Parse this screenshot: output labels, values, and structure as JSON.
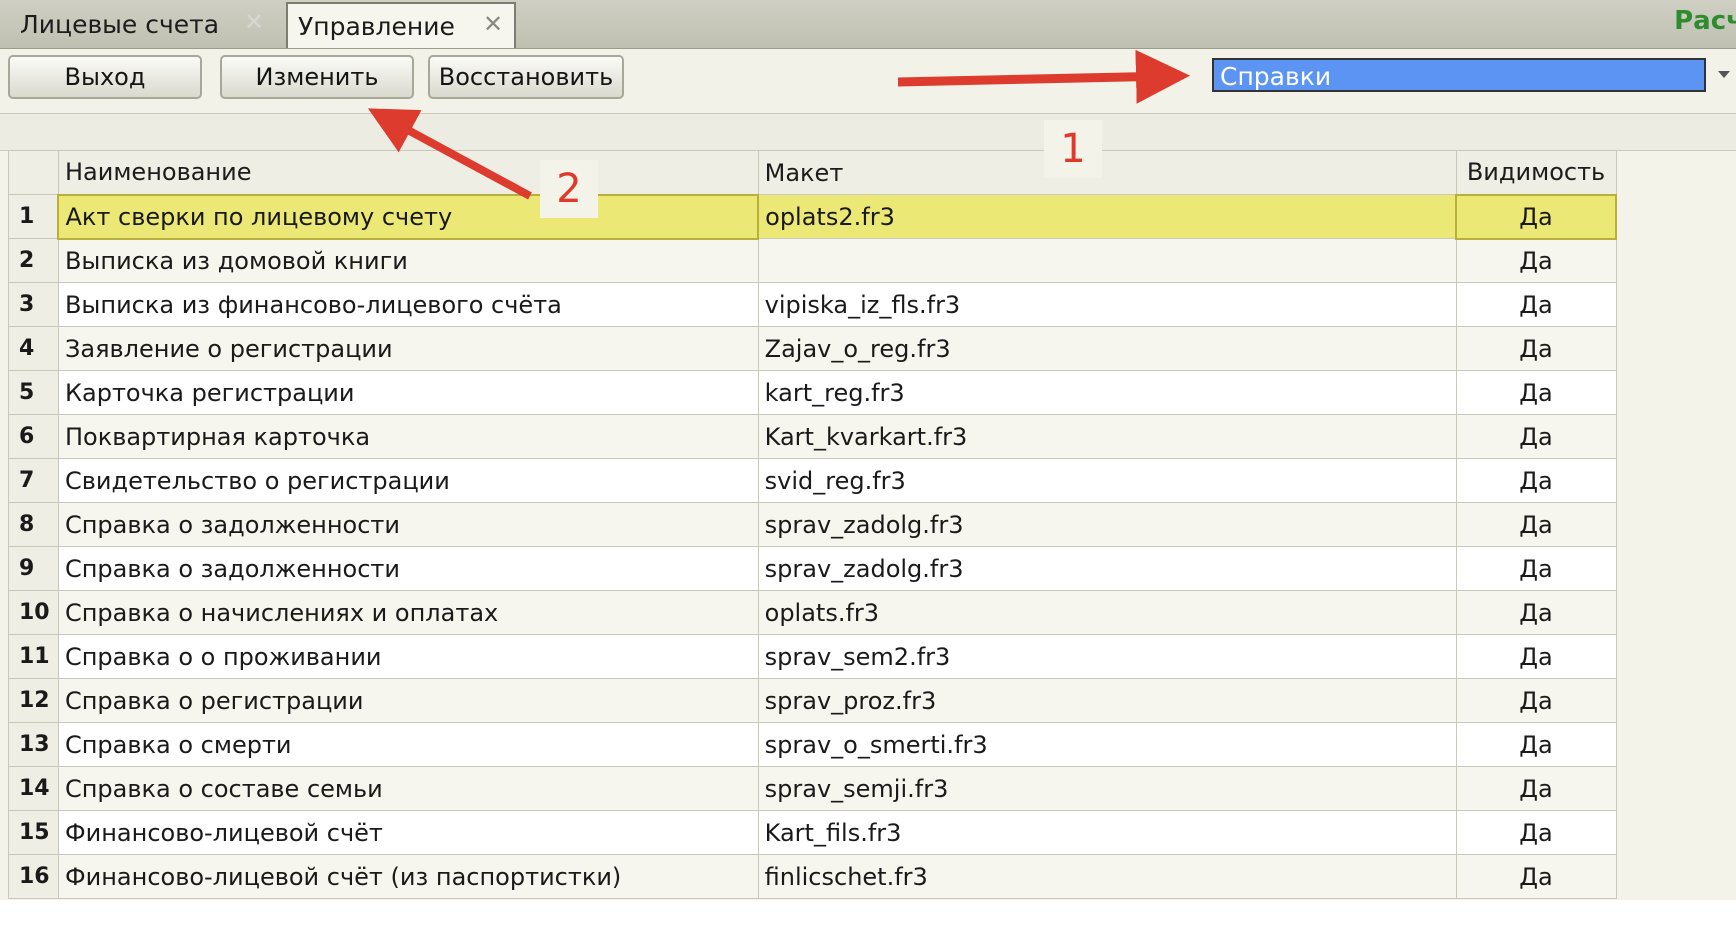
{
  "tabs": [
    {
      "label": "Лицевые счета",
      "close": "✕"
    },
    {
      "label": "Управление",
      "close": "✕"
    }
  ],
  "tab_right_text": "Расч",
  "toolbar": {
    "exit_label": "Выход",
    "edit_label": "Изменить",
    "restore_label": "Восстановить"
  },
  "dropdown": {
    "selected": "Справки",
    "icon": "chevron-down-icon"
  },
  "grid": {
    "headers": {
      "name": "Наименование",
      "template": "Макет",
      "visibility": "Видимость"
    },
    "rows": [
      {
        "num": "1",
        "name": "Акт сверки по лицевому счету",
        "template": "oplats2.fr3",
        "visibility": "Да"
      },
      {
        "num": "2",
        "name": "Выписка из домовой книги",
        "template": "",
        "visibility": "Да"
      },
      {
        "num": "3",
        "name": "Выписка из финансово-лицевого счёта",
        "template": "vipiska_iz_fls.fr3",
        "visibility": "Да"
      },
      {
        "num": "4",
        "name": "Заявление о регистрации",
        "template": "Zajav_o_reg.fr3",
        "visibility": "Да"
      },
      {
        "num": "5",
        "name": "Карточка регистрации",
        "template": "kart_reg.fr3",
        "visibility": "Да"
      },
      {
        "num": "6",
        "name": "Поквартирная карточка",
        "template": "Kart_kvarkart.fr3",
        "visibility": "Да"
      },
      {
        "num": "7",
        "name": "Свидетельство о регистрации",
        "template": "svid_reg.fr3",
        "visibility": "Да"
      },
      {
        "num": "8",
        "name": "Справка о задолженности",
        "template": "sprav_zadolg.fr3",
        "visibility": "Да"
      },
      {
        "num": "9",
        "name": "Справка о задолженности",
        "template": "sprav_zadolg.fr3",
        "visibility": "Да"
      },
      {
        "num": "10",
        "name": "Справка о начислениях и оплатах",
        "template": "oplats.fr3",
        "visibility": "Да"
      },
      {
        "num": "11",
        "name": "Справка о о проживании",
        "template": "sprav_sem2.fr3",
        "visibility": "Да"
      },
      {
        "num": "12",
        "name": "Справка о регистрации",
        "template": "sprav_proz.fr3",
        "visibility": "Да"
      },
      {
        "num": "13",
        "name": "Справка о смерти",
        "template": "sprav_o_smerti.fr3",
        "visibility": "Да"
      },
      {
        "num": "14",
        "name": "Справка о составе семьи",
        "template": "sprav_semji.fr3",
        "visibility": "Да"
      },
      {
        "num": "15",
        "name": "Финансово-лицевой счёт",
        "template": "Kart_fils.fr3",
        "visibility": "Да"
      },
      {
        "num": "16",
        "name": "Финансово-лицевой счёт (из паспортистки)",
        "template": "finlicschet.fr3",
        "visibility": "Да"
      }
    ],
    "selected_row": 1
  },
  "annotations": {
    "callout_1": "1",
    "callout_2": "2",
    "arrow_color": "#dc3b2e"
  }
}
